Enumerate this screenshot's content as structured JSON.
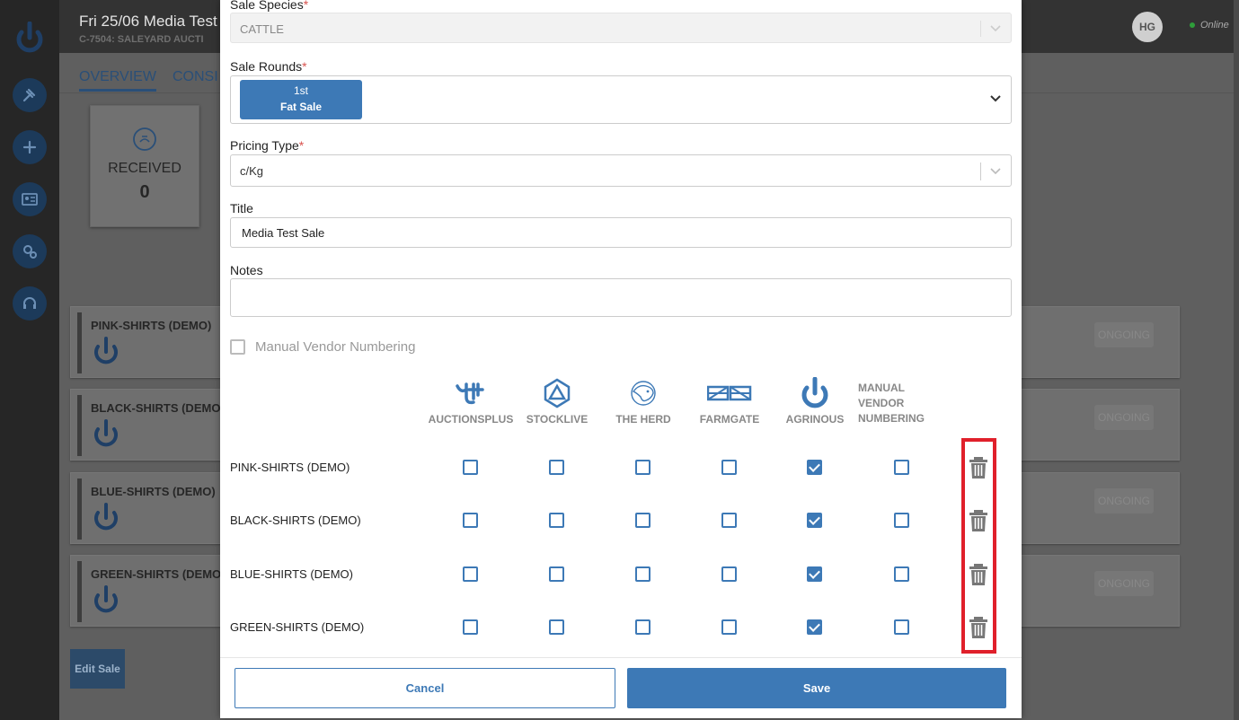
{
  "app": {
    "title": "Fri 25/06 Media Test",
    "subtitle": "C-7504: SALEYARD AUCTI",
    "user_initials": "HG",
    "status": "Online",
    "tabs": [
      {
        "label": "OVERVIEW"
      },
      {
        "label": "CONSI"
      }
    ],
    "stat": {
      "label": "RECEIVED",
      "value": "0"
    },
    "vendors": [
      {
        "name": "PINK-SHIRTS (DEMO)",
        "status": "ONGOING"
      },
      {
        "name": "BLACK-SHIRTS (DEMO)",
        "status": "ONGOING"
      },
      {
        "name": "BLUE-SHIRTS (DEMO)",
        "status": "ONGOING"
      },
      {
        "name": "GREEN-SHIRTS (DEMO)",
        "status": "ONGOING"
      }
    ],
    "edit_sale_label": "Edit Sale"
  },
  "modal": {
    "species": {
      "label": "Sale Species",
      "required_mark": "*",
      "value": "CATTLE"
    },
    "rounds": {
      "label": "Sale Rounds",
      "required_mark": "*",
      "chip_line1": "1st",
      "chip_line2": "Fat Sale"
    },
    "pricing": {
      "label": "Pricing Type",
      "required_mark": "*",
      "value": "c/Kg"
    },
    "title_field": {
      "label": "Title",
      "value": "Media Test Sale"
    },
    "notes_field": {
      "label": "Notes",
      "value": ""
    },
    "manual_vendor_numbering": {
      "label": "Manual Vendor Numbering",
      "checked": false
    },
    "columns": [
      {
        "label": "AUCTIONSPLUS",
        "icon": "auctionsplus-logo-icon"
      },
      {
        "label": "STOCKLIVE",
        "icon": "stocklive-logo-icon"
      },
      {
        "label": "THE HERD",
        "icon": "the-herd-logo-icon"
      },
      {
        "label": "FARMGATE",
        "icon": "farmgate-logo-icon"
      },
      {
        "label": "AGRINOUS",
        "icon": "agrinous-logo-icon"
      },
      {
        "label_lines": [
          "MANUAL",
          "VENDOR",
          "NUMBERING"
        ]
      }
    ],
    "rows": [
      {
        "name": "PINK-SHIRTS (DEMO)",
        "checks": [
          false,
          false,
          false,
          false,
          true,
          false
        ]
      },
      {
        "name": "BLACK-SHIRTS (DEMO)",
        "checks": [
          false,
          false,
          false,
          false,
          true,
          false
        ]
      },
      {
        "name": "BLUE-SHIRTS (DEMO)",
        "checks": [
          false,
          false,
          false,
          false,
          true,
          false
        ]
      },
      {
        "name": "GREEN-SHIRTS (DEMO)",
        "checks": [
          false,
          false,
          false,
          false,
          true,
          false
        ]
      }
    ],
    "cancel_label": "Cancel",
    "save_label": "Save",
    "colors": {
      "primary": "#3d79b6",
      "highlight": "#e0202b",
      "required": "#d9534f"
    }
  }
}
